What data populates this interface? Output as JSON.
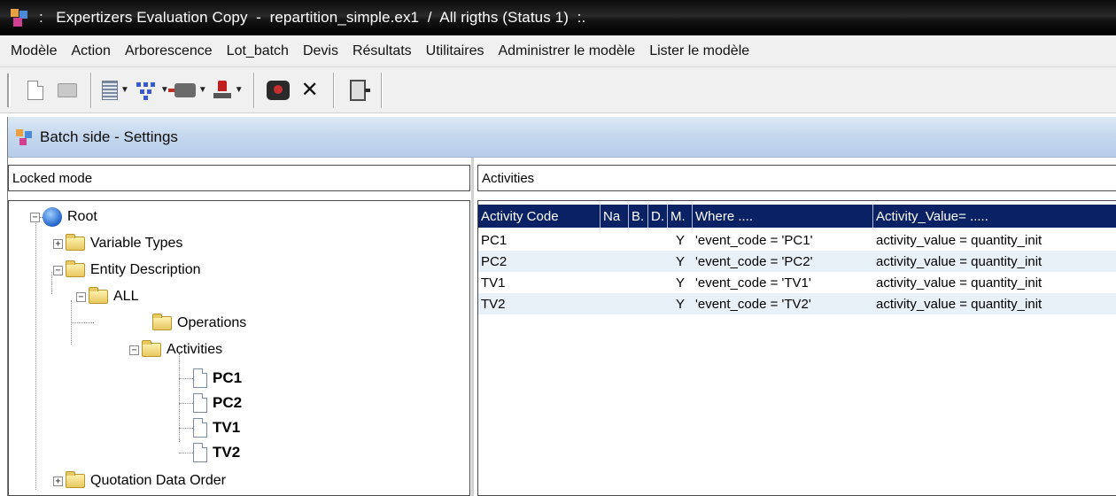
{
  "window": {
    "title": ":   Expertizers Evaluation Copy  -  repartition_simple.ex1  /  All rigths (Status 1)  :."
  },
  "menubar": {
    "items": [
      "Modèle",
      "Action",
      "Arborescence",
      "Lot_batch",
      "Devis",
      "Résultats",
      "Utilitaires",
      "Administrer le modèle",
      "Lister le modèle"
    ]
  },
  "toolbar": {
    "icons": [
      "new-document-icon",
      "open-folder-icon",
      "list-icon",
      "tree-icon",
      "connector-icon",
      "stamp-icon",
      "camera-icon",
      "close-icon",
      "exit-icon"
    ]
  },
  "inner_window": {
    "title": "Batch side - Settings"
  },
  "left_panel": {
    "mode_label": "Locked mode",
    "tree": {
      "root": "Root",
      "variable_types": "Variable Types",
      "entity_description": "Entity Description",
      "all": "ALL",
      "operations": "Operations",
      "activities": "Activities",
      "leaves": [
        "PC1",
        "PC2",
        "TV1",
        "TV2"
      ],
      "quotation": "Quotation Data Order"
    }
  },
  "right_panel": {
    "section_label": "Activities",
    "grid": {
      "columns": [
        "Activity Code",
        "Na",
        "B.",
        "D.",
        "M.",
        "Where ....",
        "Activity_Value= ....."
      ],
      "rows": [
        {
          "code": "PC1",
          "na": "",
          "b": "",
          "d": "",
          "m": "Y",
          "where": "'event_code = 'PC1'",
          "value": "activity_value = quantity_init"
        },
        {
          "code": "PC2",
          "na": "",
          "b": "",
          "d": "",
          "m": "Y",
          "where": "'event_code = 'PC2'",
          "value": "activity_value = quantity_init"
        },
        {
          "code": "TV1",
          "na": "",
          "b": "",
          "d": "",
          "m": "Y",
          "where": "'event_code = 'TV1'",
          "value": "activity_value = quantity_init"
        },
        {
          "code": "TV2",
          "na": "",
          "b": "",
          "d": "",
          "m": "Y",
          "where": "'event_code = 'TV2'",
          "value": "activity_value = quantity_init"
        }
      ]
    }
  }
}
